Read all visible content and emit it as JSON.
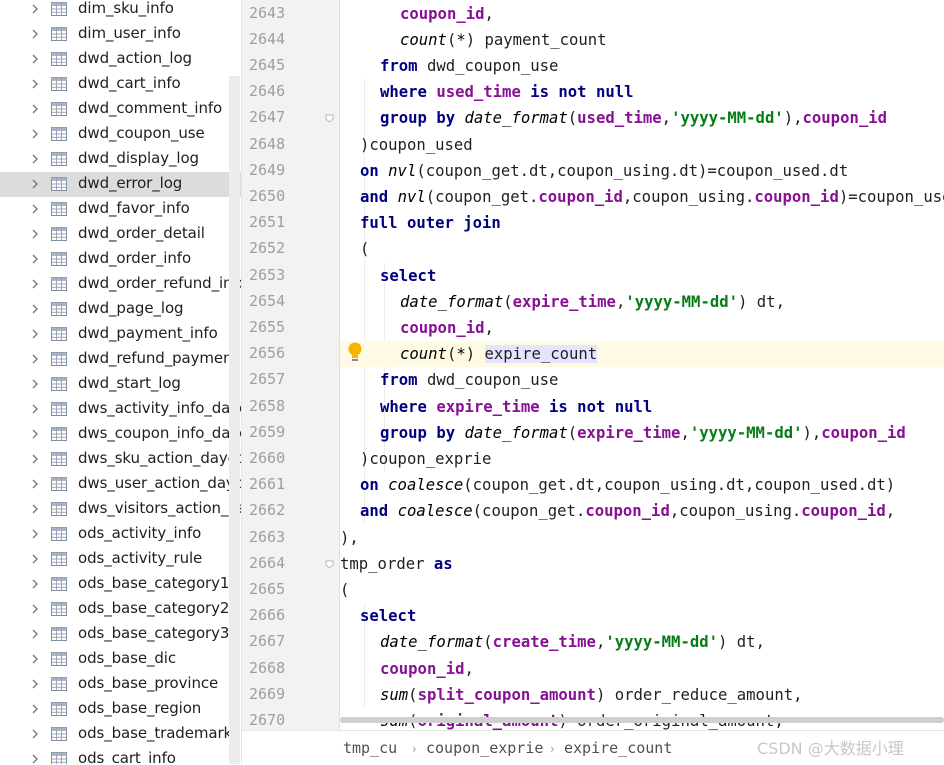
{
  "tree": {
    "items": [
      {
        "label": "dim_sku_info"
      },
      {
        "label": "dim_user_info"
      },
      {
        "label": "dwd_action_log"
      },
      {
        "label": "dwd_cart_info"
      },
      {
        "label": "dwd_comment_info"
      },
      {
        "label": "dwd_coupon_use"
      },
      {
        "label": "dwd_display_log"
      },
      {
        "label": "dwd_error_log",
        "selected": true
      },
      {
        "label": "dwd_favor_info"
      },
      {
        "label": "dwd_order_detail"
      },
      {
        "label": "dwd_order_info"
      },
      {
        "label": "dwd_order_refund_info"
      },
      {
        "label": "dwd_page_log"
      },
      {
        "label": "dwd_payment_info"
      },
      {
        "label": "dwd_refund_payment"
      },
      {
        "label": "dwd_start_log"
      },
      {
        "label": "dws_activity_info_daycount"
      },
      {
        "label": "dws_coupon_info_daycount"
      },
      {
        "label": "dws_sku_action_daycount"
      },
      {
        "label": "dws_user_action_daycount"
      },
      {
        "label": "dws_visitors_action_daycount"
      },
      {
        "label": "ods_activity_info"
      },
      {
        "label": "ods_activity_rule"
      },
      {
        "label": "ods_base_category1"
      },
      {
        "label": "ods_base_category2"
      },
      {
        "label": "ods_base_category3"
      },
      {
        "label": "ods_base_dic"
      },
      {
        "label": "ods_base_province"
      },
      {
        "label": "ods_base_region"
      },
      {
        "label": "ods_base_trademark"
      },
      {
        "label": "ods_cart_info"
      }
    ]
  },
  "editor": {
    "current_line": "2656",
    "lines": [
      {
        "no": "2643",
        "indent": 6,
        "tokens": [
          {
            "t": "coupon_id",
            "c": "col"
          },
          {
            "t": ",",
            "c": ""
          }
        ]
      },
      {
        "no": "2644",
        "indent": 6,
        "tokens": [
          {
            "t": "count",
            "c": "fn"
          },
          {
            "t": "(",
            "c": ""
          },
          {
            "t": "*",
            "c": "fn"
          },
          {
            "t": ") payment_count",
            "c": ""
          }
        ]
      },
      {
        "no": "2645",
        "indent": 4,
        "tokens": [
          {
            "t": "from",
            "c": "kw"
          },
          {
            "t": " dwd_coupon_use",
            "c": ""
          }
        ]
      },
      {
        "no": "2646",
        "indent": 4,
        "tokens": [
          {
            "t": "where",
            "c": "kw"
          },
          {
            "t": " ",
            "c": ""
          },
          {
            "t": "used_time",
            "c": "col"
          },
          {
            "t": " ",
            "c": ""
          },
          {
            "t": "is not null",
            "c": "kw"
          }
        ]
      },
      {
        "no": "2647",
        "indent": 4,
        "tokens": [
          {
            "t": "group by",
            "c": "kw"
          },
          {
            "t": " ",
            "c": ""
          },
          {
            "t": "date_format",
            "c": "fn"
          },
          {
            "t": "(",
            "c": ""
          },
          {
            "t": "used_time",
            "c": "col"
          },
          {
            "t": ",",
            "c": ""
          },
          {
            "t": "'yyyy-MM-dd'",
            "c": "str"
          },
          {
            "t": "),",
            "c": ""
          },
          {
            "t": "coupon_id",
            "c": "col"
          }
        ]
      },
      {
        "no": "2648",
        "indent": 2,
        "tokens": [
          {
            "t": ")coupon_used",
            "c": ""
          }
        ]
      },
      {
        "no": "2649",
        "indent": 2,
        "tokens": [
          {
            "t": "on",
            "c": "kw"
          },
          {
            "t": " ",
            "c": ""
          },
          {
            "t": "nvl",
            "c": "fn"
          },
          {
            "t": "(coupon_get.dt,coupon_using.dt)=coupon_used.dt",
            "c": ""
          }
        ]
      },
      {
        "no": "2650",
        "indent": 2,
        "tokens": [
          {
            "t": "and",
            "c": "kw"
          },
          {
            "t": " ",
            "c": ""
          },
          {
            "t": "nvl",
            "c": "fn"
          },
          {
            "t": "(coupon_get.",
            "c": ""
          },
          {
            "t": "coupon_id",
            "c": "col"
          },
          {
            "t": ",coupon_using.",
            "c": ""
          },
          {
            "t": "coupon_id",
            "c": "col"
          },
          {
            "t": ")=coupon_used.",
            "c": ""
          },
          {
            "t": "coupon_id",
            "c": "col"
          }
        ]
      },
      {
        "no": "2651",
        "indent": 2,
        "tokens": [
          {
            "t": "full outer join",
            "c": "kw"
          }
        ]
      },
      {
        "no": "2652",
        "indent": 2,
        "tokens": [
          {
            "t": "(",
            "c": ""
          }
        ]
      },
      {
        "no": "2653",
        "indent": 4,
        "tokens": [
          {
            "t": "select",
            "c": "kw"
          }
        ]
      },
      {
        "no": "2654",
        "indent": 6,
        "tokens": [
          {
            "t": "date_format",
            "c": "fn"
          },
          {
            "t": "(",
            "c": ""
          },
          {
            "t": "expire_time",
            "c": "col"
          },
          {
            "t": ",",
            "c": ""
          },
          {
            "t": "'yyyy-MM-dd'",
            "c": "str"
          },
          {
            "t": ") dt,",
            "c": ""
          }
        ]
      },
      {
        "no": "2655",
        "indent": 6,
        "tokens": [
          {
            "t": "coupon_id",
            "c": "col"
          },
          {
            "t": ",",
            "c": ""
          }
        ]
      },
      {
        "no": "2656",
        "indent": 6,
        "tokens": [
          {
            "t": "count",
            "c": "fn"
          },
          {
            "t": "(",
            "c": ""
          },
          {
            "t": "*",
            "c": "fn"
          },
          {
            "t": ") ",
            "c": ""
          },
          {
            "t": "expire_count",
            "c": "hl"
          }
        ]
      },
      {
        "no": "2657",
        "indent": 4,
        "tokens": [
          {
            "t": "from",
            "c": "kw"
          },
          {
            "t": " dwd_coupon_use",
            "c": ""
          }
        ]
      },
      {
        "no": "2658",
        "indent": 4,
        "tokens": [
          {
            "t": "where",
            "c": "kw"
          },
          {
            "t": " ",
            "c": ""
          },
          {
            "t": "expire_time",
            "c": "col"
          },
          {
            "t": " ",
            "c": ""
          },
          {
            "t": "is not null",
            "c": "kw"
          }
        ]
      },
      {
        "no": "2659",
        "indent": 4,
        "tokens": [
          {
            "t": "group by",
            "c": "kw"
          },
          {
            "t": " ",
            "c": ""
          },
          {
            "t": "date_format",
            "c": "fn"
          },
          {
            "t": "(",
            "c": ""
          },
          {
            "t": "expire_time",
            "c": "col"
          },
          {
            "t": ",",
            "c": ""
          },
          {
            "t": "'yyyy-MM-dd'",
            "c": "str"
          },
          {
            "t": "),",
            "c": ""
          },
          {
            "t": "coupon_id",
            "c": "col"
          }
        ]
      },
      {
        "no": "2660",
        "indent": 2,
        "tokens": [
          {
            "t": ")coupon_exprie",
            "c": ""
          }
        ]
      },
      {
        "no": "2661",
        "indent": 2,
        "tokens": [
          {
            "t": "on",
            "c": "kw"
          },
          {
            "t": " ",
            "c": ""
          },
          {
            "t": "coalesce",
            "c": "fn"
          },
          {
            "t": "(coupon_get.dt,coupon_using.dt,coupon_used.dt)",
            "c": ""
          }
        ]
      },
      {
        "no": "2662",
        "indent": 2,
        "tokens": [
          {
            "t": "and",
            "c": "kw"
          },
          {
            "t": " ",
            "c": ""
          },
          {
            "t": "coalesce",
            "c": "fn"
          },
          {
            "t": "(coupon_get.",
            "c": ""
          },
          {
            "t": "coupon_id",
            "c": "col"
          },
          {
            "t": ",coupon_using.",
            "c": ""
          },
          {
            "t": "coupon_id",
            "c": "col"
          },
          {
            "t": ",",
            "c": ""
          }
        ]
      },
      {
        "no": "2663",
        "indent": 0,
        "tokens": [
          {
            "t": "),",
            "c": ""
          }
        ]
      },
      {
        "no": "2664",
        "indent": 0,
        "tokens": [
          {
            "t": "tmp_order ",
            "c": ""
          },
          {
            "t": "as",
            "c": "kw"
          }
        ]
      },
      {
        "no": "2665",
        "indent": 0,
        "tokens": [
          {
            "t": "(",
            "c": ""
          }
        ]
      },
      {
        "no": "2666",
        "indent": 2,
        "tokens": [
          {
            "t": "select",
            "c": "kw"
          }
        ]
      },
      {
        "no": "2667",
        "indent": 4,
        "tokens": [
          {
            "t": "date_format",
            "c": "fn"
          },
          {
            "t": "(",
            "c": ""
          },
          {
            "t": "create_time",
            "c": "col"
          },
          {
            "t": ",",
            "c": ""
          },
          {
            "t": "'yyyy-MM-dd'",
            "c": "str"
          },
          {
            "t": ") dt,",
            "c": ""
          }
        ]
      },
      {
        "no": "2668",
        "indent": 4,
        "tokens": [
          {
            "t": "coupon_id",
            "c": "col"
          },
          {
            "t": ",",
            "c": ""
          }
        ]
      },
      {
        "no": "2669",
        "indent": 4,
        "tokens": [
          {
            "t": "sum",
            "c": "fn"
          },
          {
            "t": "(",
            "c": ""
          },
          {
            "t": "split_coupon_amount",
            "c": "col"
          },
          {
            "t": ") order_reduce_amount,",
            "c": ""
          }
        ]
      },
      {
        "no": "2670",
        "indent": 4,
        "tokens": [
          {
            "t": "sum",
            "c": "fn"
          },
          {
            "t": "(",
            "c": ""
          },
          {
            "t": "original_amount",
            "c": "col"
          },
          {
            "t": ") order_original_amount,",
            "c": ""
          }
        ]
      }
    ]
  },
  "breadcrumbs": {
    "items": [
      "tmp_cu",
      "coupon_exprie",
      "expire_count"
    ]
  },
  "watermark": "CSDN @大数据小理",
  "colors": {
    "keyword": "#000080",
    "column": "#871094",
    "string": "#067d17",
    "selected_row": "#dcdcdc",
    "current_line": "#fffae3"
  },
  "icons": {
    "tree_chevron": "chevron-right-icon",
    "tree_table": "table-icon",
    "intention": "lightbulb-icon",
    "breadcrumb_separator": "chevron-right-icon"
  }
}
